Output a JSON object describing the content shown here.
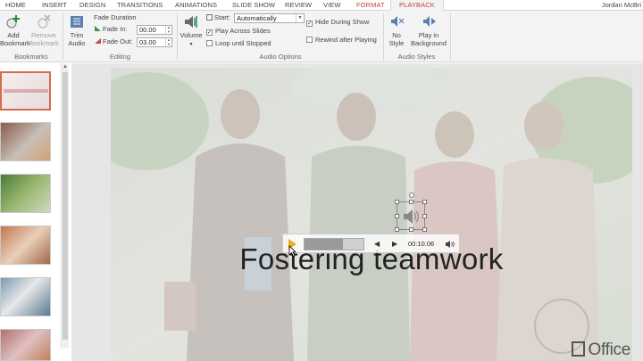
{
  "tabs": [
    "HOME",
    "INSERT",
    "DESIGN",
    "TRANSITIONS",
    "ANIMATIONS",
    "SLIDE SHOW",
    "REVIEW",
    "VIEW",
    "FORMAT",
    "PLAYBACK"
  ],
  "active_tab": "PLAYBACK",
  "user_name": "Jordan McBri",
  "ribbon": {
    "bookmarks": {
      "add_label_1": "Add",
      "add_label_2": "Bookmark",
      "remove_label_1": "Remove",
      "remove_label_2": "Bookmark",
      "group_label": "Bookmarks"
    },
    "editing": {
      "trim_label_1": "Trim",
      "trim_label_2": "Audio",
      "fade_duration_label": "Fade Duration",
      "fade_in_label": "Fade In:",
      "fade_in_value": "00.00",
      "fade_out_label": "Fade Out:",
      "fade_out_value": "03.00",
      "group_label": "Editing"
    },
    "audio_options": {
      "volume_label": "Volume",
      "start_label": "Start:",
      "start_value": "Automatically",
      "play_across_slides": "Play Across Slides",
      "play_across_checked": true,
      "loop_until_stopped": "Loop until Stopped",
      "loop_checked": false,
      "hide_during_show": "Hide During Show",
      "hide_checked": true,
      "rewind_after_playing": "Rewind after Playing",
      "rewind_checked": false,
      "group_label": "Audio Options"
    },
    "audio_styles": {
      "no_style_1": "No",
      "no_style_2": "Style",
      "play_bg_1": "Play in",
      "play_bg_2": "Background",
      "group_label": "Audio Styles"
    }
  },
  "slide": {
    "title": "Fostering teamwork",
    "logo_text": "Office"
  },
  "player": {
    "timecode": "00:10.06",
    "progress": 0.65
  },
  "colors": {
    "accent": "#b7472a",
    "selected_thumb": "#d8694c",
    "play_button": "#e8b024"
  },
  "icons": [
    "add-bookmark-icon",
    "remove-bookmark-icon",
    "trim-audio-icon",
    "volume-icon",
    "no-style-icon",
    "play-in-background-icon",
    "speaker-icon",
    "play-icon",
    "previous-icon",
    "next-icon",
    "volume-small-icon"
  ]
}
